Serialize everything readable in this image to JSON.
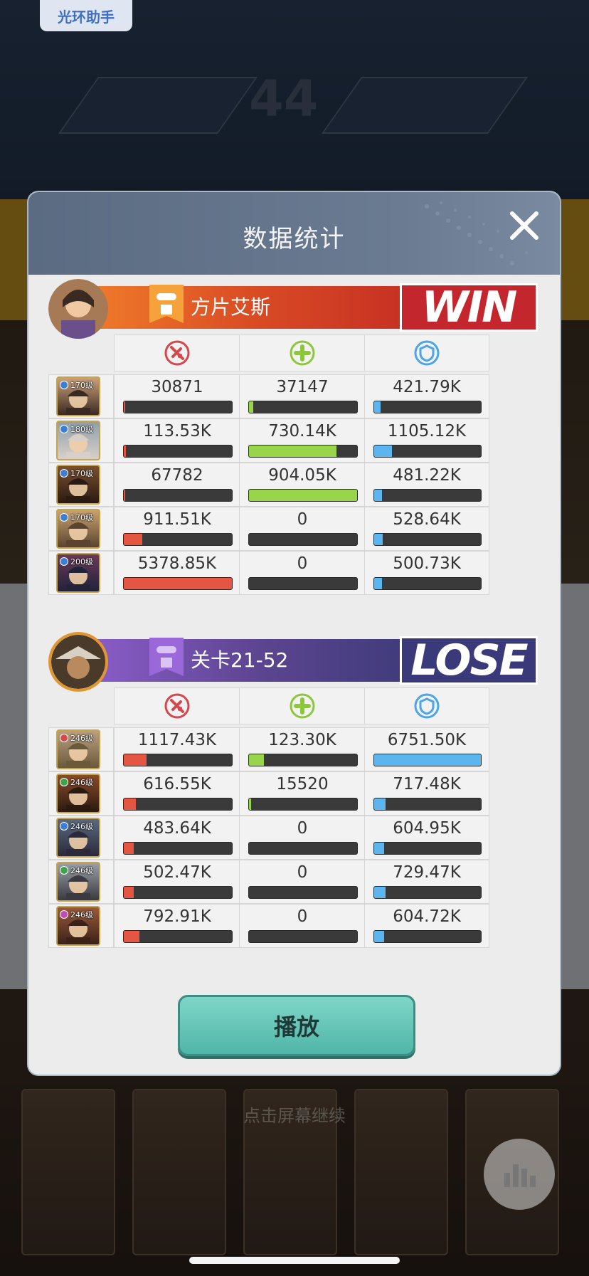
{
  "top_button": "光环助手",
  "background": {
    "hint": "点击屏幕继续",
    "stage_number": "44"
  },
  "dialog": {
    "title": "数据统计",
    "close_icon": "close-icon"
  },
  "stat_icons": [
    "damage-icon",
    "heal-icon",
    "shield-icon"
  ],
  "colors": {
    "damage": "#e45542",
    "heal": "#98d54b",
    "tank": "#5cb5ee",
    "win": "#c3262c",
    "lose": "#3a3a7a"
  },
  "teams": [
    {
      "name": "方片艾斯",
      "result": "WIN",
      "heroes": [
        {
          "level": "170级",
          "gem": "#3a7fd5",
          "damage": "30871",
          "damage_pct": 0.6,
          "heal": "37147",
          "heal_pct": 4.1,
          "tank": "421.79K",
          "tank_pct": 6.2
        },
        {
          "level": "180级",
          "gem": "#3a7fd5",
          "damage": "113.53K",
          "damage_pct": 2.1,
          "heal": "730.14K",
          "heal_pct": 80.8,
          "tank": "1105.12K",
          "tank_pct": 16.4
        },
        {
          "level": "170级",
          "gem": "#3a7fd5",
          "damage": "67782",
          "damage_pct": 1.3,
          "heal": "904.05K",
          "heal_pct": 100,
          "tank": "481.22K",
          "tank_pct": 7.1
        },
        {
          "level": "170级",
          "gem": "#3a7fd5",
          "damage": "911.51K",
          "damage_pct": 16.9,
          "heal": "0",
          "heal_pct": 0,
          "tank": "528.64K",
          "tank_pct": 7.8
        },
        {
          "level": "200级",
          "gem": "#3a7fd5",
          "damage": "5378.85K",
          "damage_pct": 100,
          "heal": "0",
          "heal_pct": 0,
          "tank": "500.73K",
          "tank_pct": 7.4
        }
      ]
    },
    {
      "name": "关卡21-52",
      "result": "LOSE",
      "heroes": [
        {
          "level": "246级",
          "gem": "#d84a4a",
          "damage": "1117.43K",
          "damage_pct": 20.8,
          "heal": "123.30K",
          "heal_pct": 13.6,
          "tank": "6751.50K",
          "tank_pct": 100
        },
        {
          "level": "246级",
          "gem": "#3fa34a",
          "damage": "616.55K",
          "damage_pct": 11.5,
          "heal": "15520",
          "heal_pct": 1.7,
          "tank": "717.48K",
          "tank_pct": 10.6
        },
        {
          "level": "246级",
          "gem": "#3a7fd5",
          "damage": "483.64K",
          "damage_pct": 9.0,
          "heal": "0",
          "heal_pct": 0,
          "tank": "604.95K",
          "tank_pct": 9.0
        },
        {
          "level": "246级",
          "gem": "#3fa34a",
          "damage": "502.47K",
          "damage_pct": 9.3,
          "heal": "0",
          "heal_pct": 0,
          "tank": "729.47K",
          "tank_pct": 10.8
        },
        {
          "level": "246级",
          "gem": "#c24ab0",
          "damage": "792.91K",
          "damage_pct": 14.7,
          "heal": "0",
          "heal_pct": 0,
          "tank": "604.72K",
          "tank_pct": 9.0
        }
      ]
    }
  ],
  "play_button": "播放"
}
